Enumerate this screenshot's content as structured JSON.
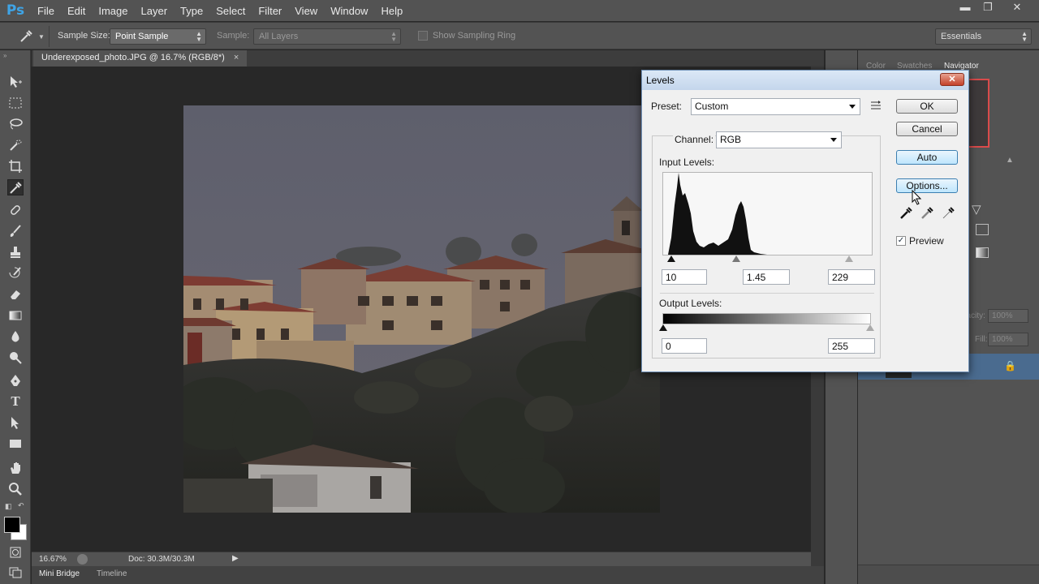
{
  "app": {
    "logo": "Ps"
  },
  "menu": [
    "File",
    "Edit",
    "Image",
    "Layer",
    "Type",
    "Select",
    "Filter",
    "View",
    "Window",
    "Help"
  ],
  "window_controls": {
    "minimize": "▬",
    "restore": "❐",
    "close": "✕"
  },
  "options_bar": {
    "sample_size_label": "Sample Size:",
    "sample_size_value": "Point Sample",
    "sample_label": "Sample:",
    "sample_value": "All Layers",
    "sampling_ring_label": "Show Sampling Ring",
    "workspace_value": "Essentials"
  },
  "document": {
    "tab_title": "Underexposed_photo.JPG @ 16.7% (RGB/8*)",
    "tab_close": "×"
  },
  "status_bar": {
    "zoom": "16.67%",
    "doc_info": "Doc: 30.3M/30.3M"
  },
  "bottom_tabs": [
    "Mini Bridge",
    "Timeline"
  ],
  "panels": {
    "tabs": [
      "Color",
      "Swatches",
      "Navigator"
    ],
    "opacity_label": "pacity:",
    "opacity_value": "100%",
    "fill_label": "Fill:",
    "fill_value": "100%"
  },
  "levels_dialog": {
    "title": "Levels",
    "close_icon": "✕",
    "preset_label": "Preset:",
    "preset_value": "Custom",
    "channel_label": "Channel:",
    "channel_value": "RGB",
    "input_levels_label": "Input Levels:",
    "input_black": "10",
    "input_gamma": "1.45",
    "input_white": "229",
    "output_levels_label": "Output Levels:",
    "output_black": "0",
    "output_white": "255",
    "buttons": {
      "ok": "OK",
      "cancel": "Cancel",
      "auto": "Auto",
      "options": "Options..."
    },
    "preview_label": "Preview",
    "preview_checked": true
  },
  "colors": {
    "ui_panel": "#535353",
    "ui_dark": "#282828",
    "ps_blue": "#3fa4e6",
    "dialog_bg": "#f0f0f0",
    "dialog_title": "#c4d6ec"
  }
}
